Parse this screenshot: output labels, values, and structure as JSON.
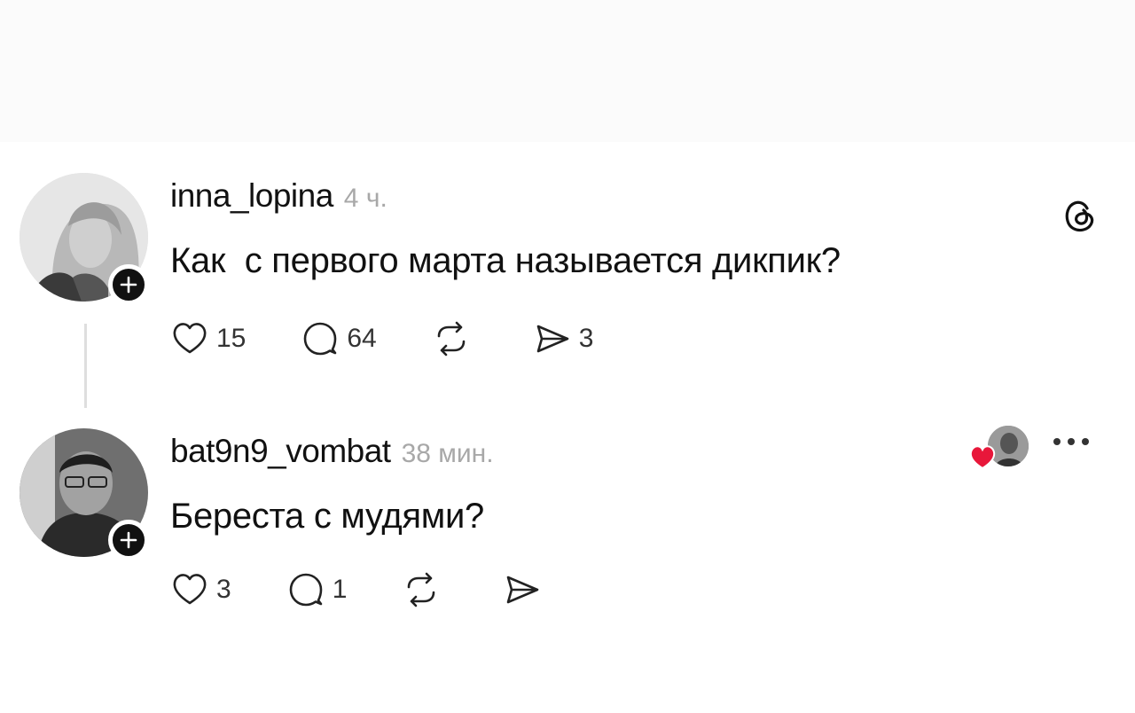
{
  "posts": [
    {
      "username": "inna_lopina",
      "time": "4 ч.",
      "text": "Как  с первого марта называется дикпик?",
      "actions": {
        "likes": "15",
        "comments": "64",
        "reposts": "",
        "shares": "3"
      }
    },
    {
      "username": "bat9n9_vombat",
      "time": "38 мин.",
      "text": "Береста с мудями?",
      "actions": {
        "likes": "3",
        "comments": "1",
        "reposts": "",
        "shares": ""
      }
    }
  ],
  "icons": {
    "like": "heart-outline-icon",
    "comment": "speech-bubble-icon",
    "repost": "repost-arrows-icon",
    "share": "paper-plane-icon",
    "app": "threads-logo-icon",
    "more": "more-dots-icon"
  },
  "colors": {
    "liked_heart": "#e8173a",
    "muted_text": "#a8a8a8",
    "text": "#111111"
  }
}
